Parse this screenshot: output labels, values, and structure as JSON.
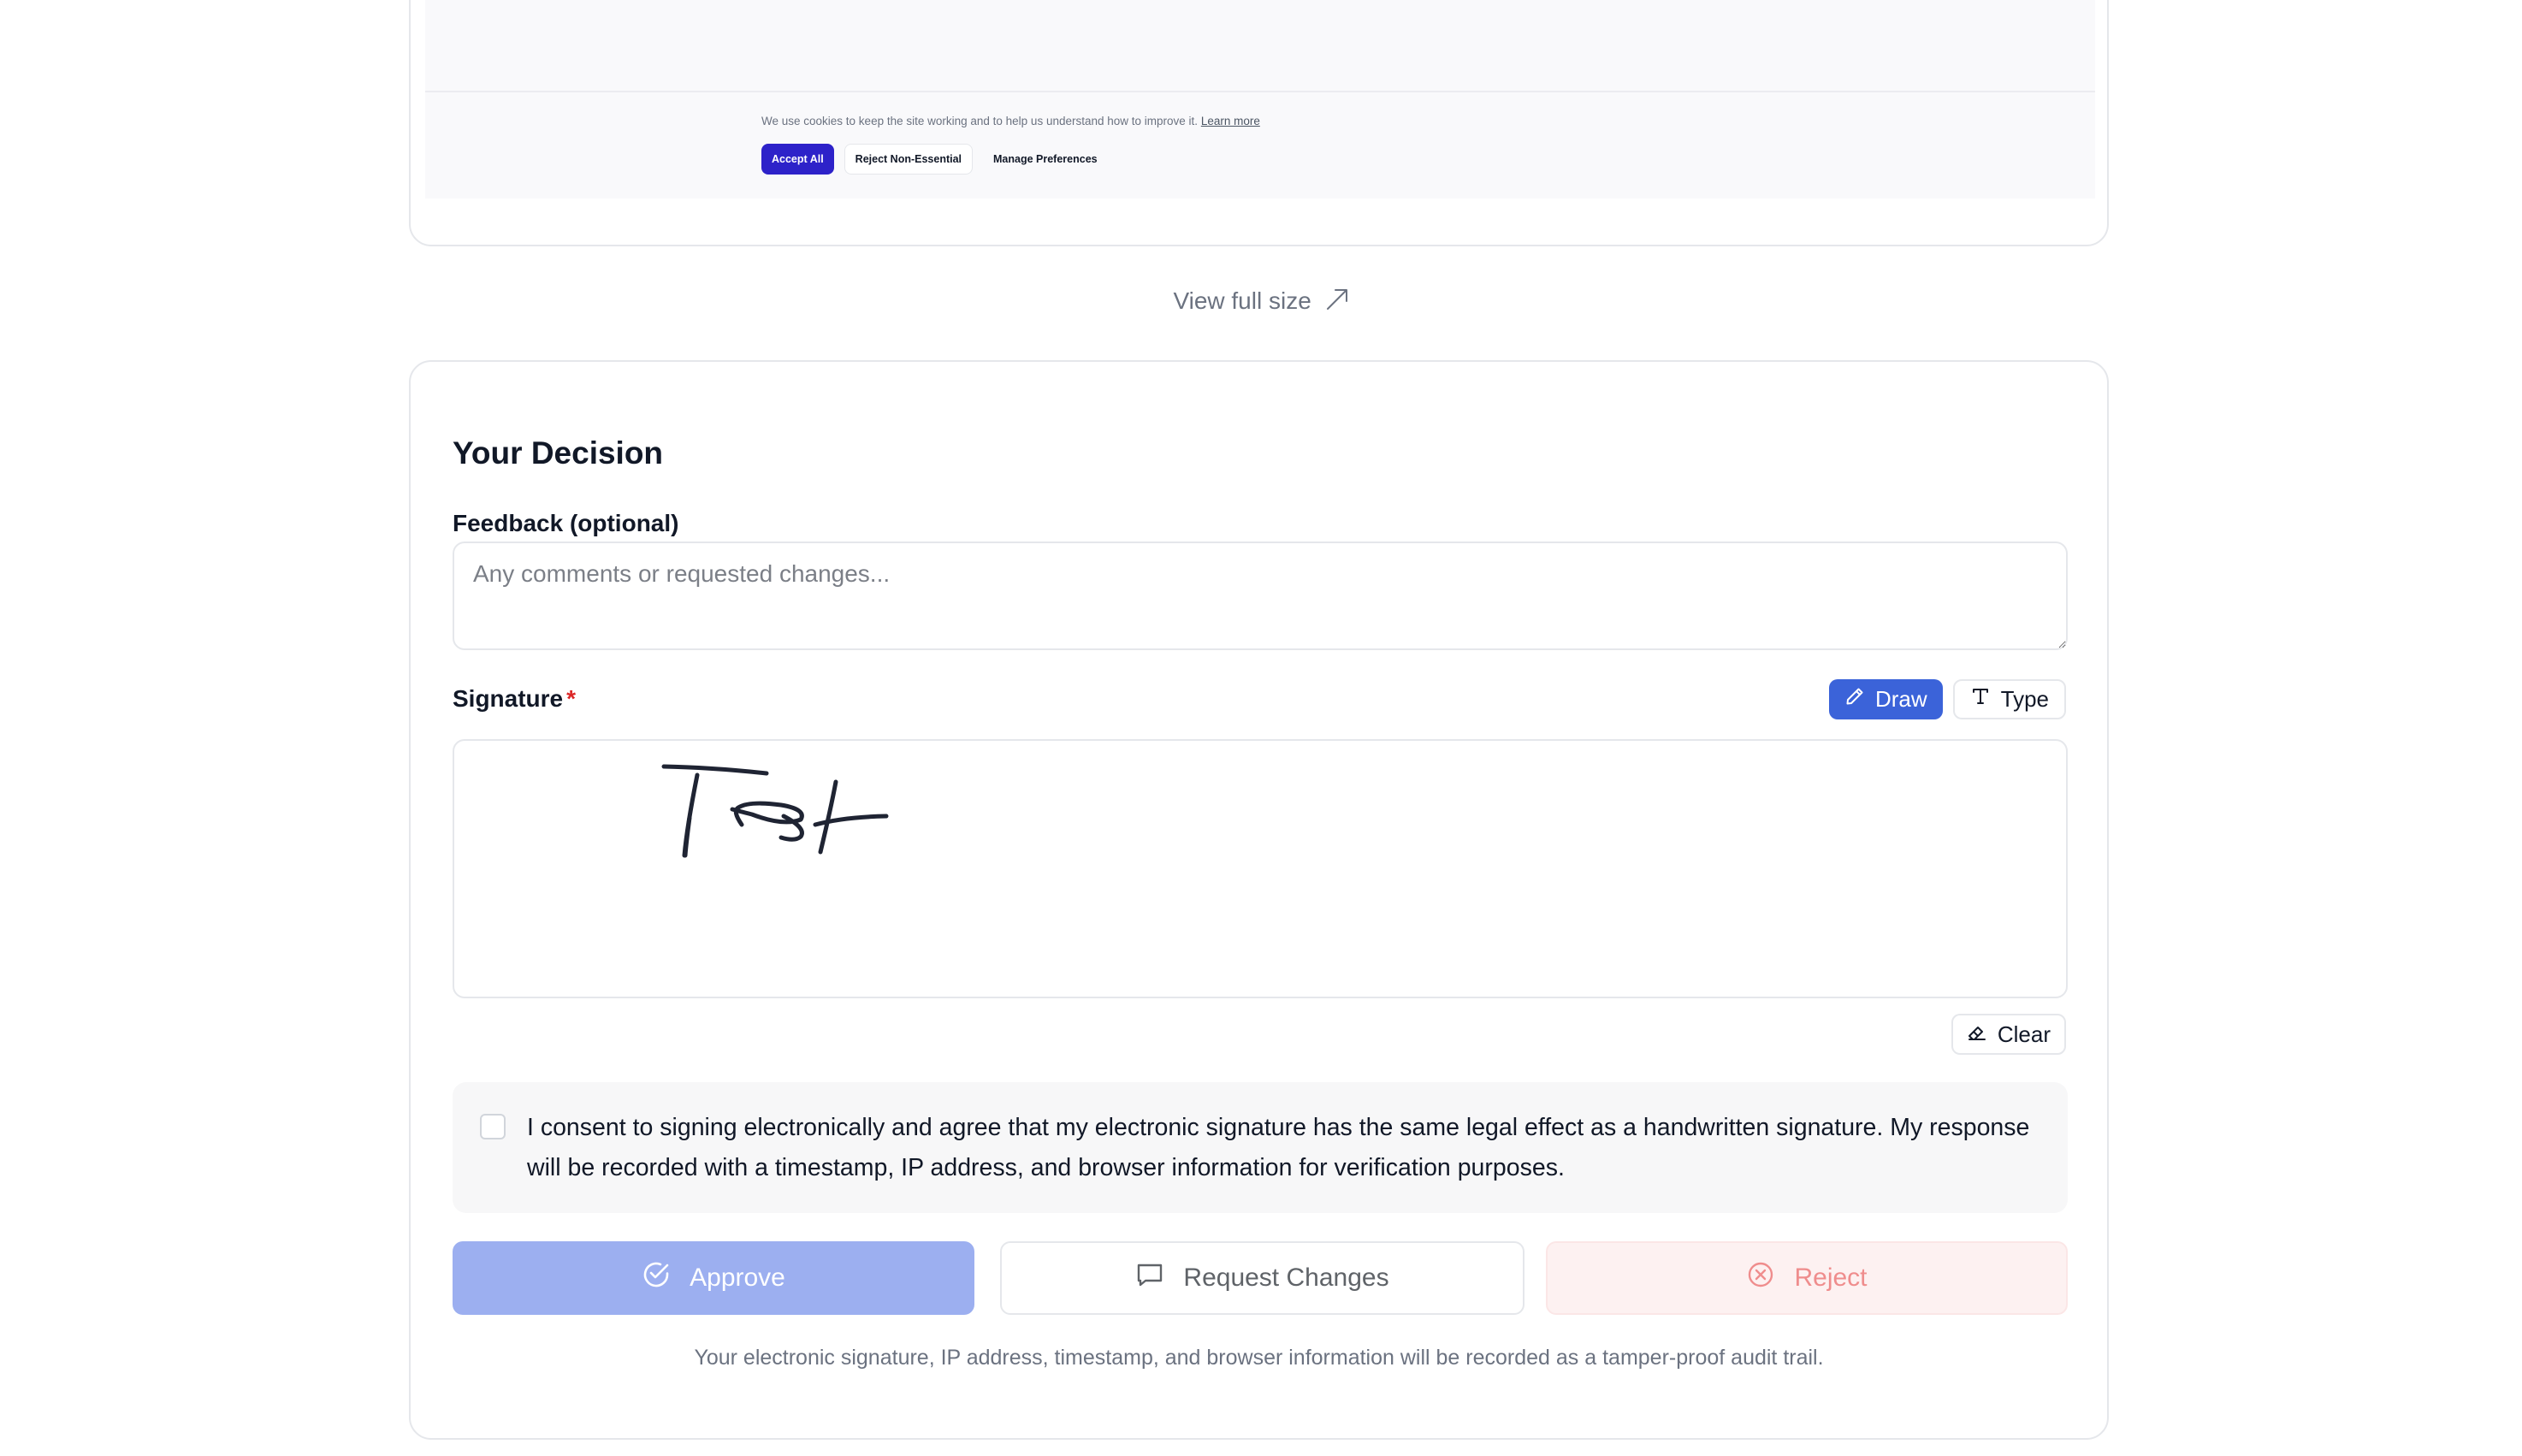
{
  "preview": {
    "cookie_text": "We use cookies to keep the site working and to help us understand how to improve it.",
    "learn_more": "Learn more",
    "accept_all": "Accept All",
    "reject_non_essential": "Reject Non-Essential",
    "manage_preferences": "Manage Preferences",
    "accent_color": "#2d22c9"
  },
  "view_full_size": "View full size",
  "decision": {
    "title": "Your Decision",
    "feedback_label": "Feedback (optional)",
    "feedback_placeholder": "Any comments or requested changes...",
    "feedback_value": "",
    "signature_label": "Signature",
    "required_marker": "*",
    "mode_draw": "Draw",
    "mode_type": "Type",
    "active_mode": "Draw",
    "signature_drawn_text": "Test",
    "clear": "Clear",
    "consent_checked": false,
    "consent_text": "I consent to signing electronically and agree that my electronic signature has the same legal effect as a handwritten signature. My response will be recorded with a timestamp, IP address, and browser information for verification purposes.",
    "approve": "Approve",
    "request_changes": "Request Changes",
    "reject": "Reject",
    "audit_note": "Your electronic signature, IP address, timestamp, and browser information will be recorded as a tamper-proof audit trail.",
    "colors": {
      "primary": "#3b63d9",
      "approve_disabled": "#9caff0",
      "reject_text": "#ef8d8d",
      "required": "#dc2626"
    }
  },
  "icons": {
    "view_full": "arrow-up-right-icon",
    "draw": "pencil-icon",
    "type": "type-icon",
    "clear": "eraser-icon",
    "approve": "check-circle-icon",
    "request": "message-square-icon",
    "reject": "x-circle-icon"
  }
}
